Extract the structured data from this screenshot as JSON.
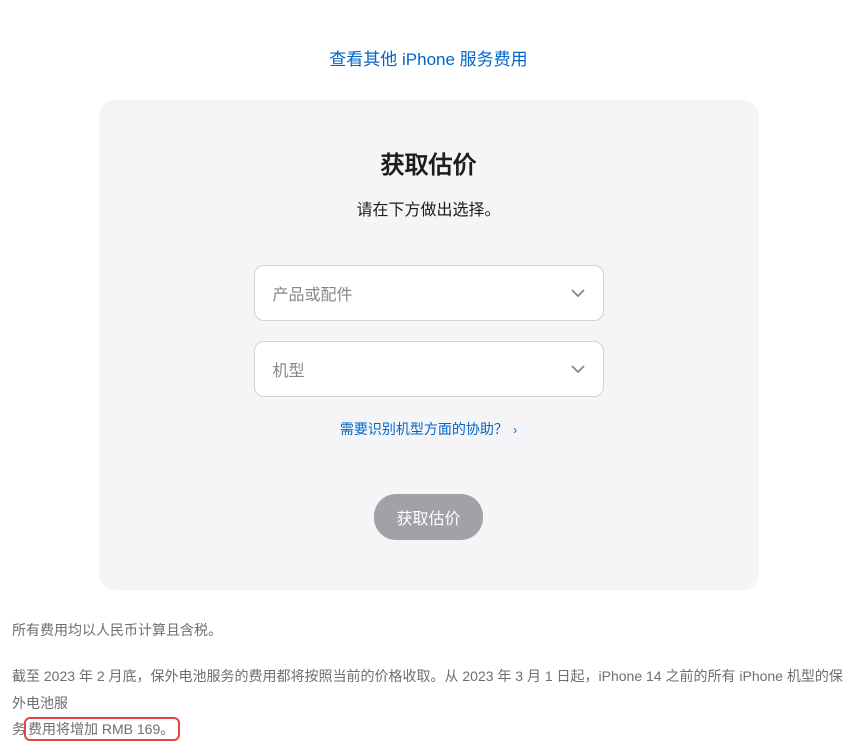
{
  "topLink": "查看其他 iPhone 服务费用",
  "card": {
    "title": "获取估价",
    "subtitle": "请在下方做出选择。",
    "select1Placeholder": "产品或配件",
    "select2Placeholder": "机型",
    "helpLink": "需要识别机型方面的协助？",
    "button": "获取估价"
  },
  "note1": "所有费用均以人民币计算且含税。",
  "note2": {
    "line1": "截至 2023 年 2 月底，保外电池服务的费用都将按照当前的价格收取。从 2023 年 3 月 1 日起，iPhone 14 之前的所有 iPhone 机型的保外电池服",
    "line2prefix": "务",
    "highlighted": "费用将增加 RMB 169。"
  }
}
